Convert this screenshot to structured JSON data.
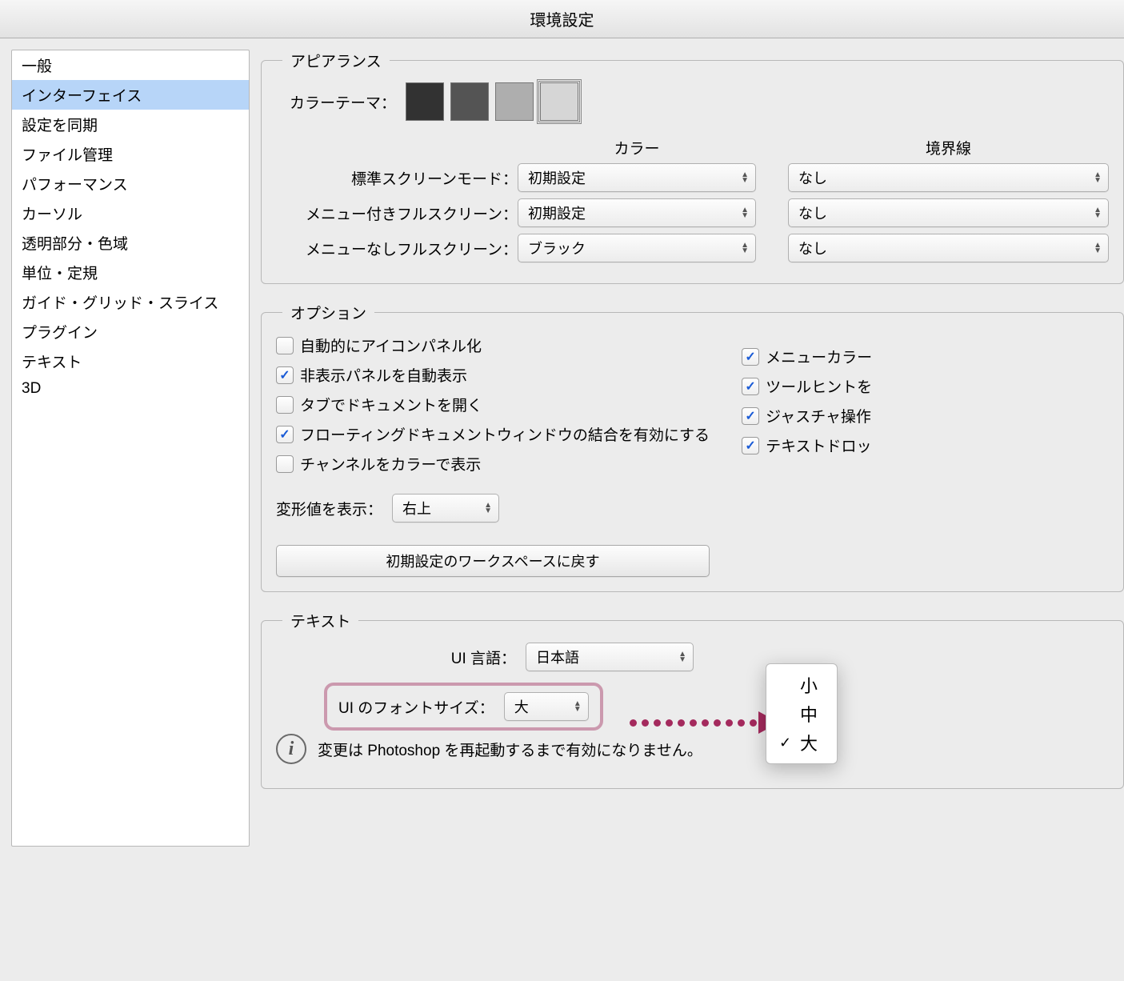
{
  "title": "環境設定",
  "sidebar": {
    "items": [
      {
        "label": "一般"
      },
      {
        "label": "インターフェイス",
        "selected": true
      },
      {
        "label": "設定を同期"
      },
      {
        "label": "ファイル管理"
      },
      {
        "label": "パフォーマンス"
      },
      {
        "label": "カーソル"
      },
      {
        "label": "透明部分・色域"
      },
      {
        "label": "単位・定規"
      },
      {
        "label": "ガイド・グリッド・スライス"
      },
      {
        "label": "プラグイン"
      },
      {
        "label": "テキスト"
      },
      {
        "label": "3D"
      }
    ]
  },
  "appearance": {
    "legend": "アピアランス",
    "color_theme_label": "カラーテーマ：",
    "swatches": [
      {
        "color": "#323232"
      },
      {
        "color": "#545454"
      },
      {
        "color": "#aeaeae"
      },
      {
        "color": "#d6d6d6",
        "selected": true
      }
    ],
    "column_color": "カラー",
    "column_border": "境界線",
    "rows": [
      {
        "label": "標準スクリーンモード：",
        "color_value": "初期設定",
        "border_value": "なし"
      },
      {
        "label": "メニュー付きフルスクリーン：",
        "color_value": "初期設定",
        "border_value": "なし"
      },
      {
        "label": "メニューなしフルスクリーン：",
        "color_value": "ブラック",
        "border_value": "なし"
      }
    ]
  },
  "options": {
    "legend": "オプション",
    "left": [
      {
        "label": "自動的にアイコンパネル化",
        "checked": false
      },
      {
        "label": "非表示パネルを自動表示",
        "checked": true
      },
      {
        "label": "タブでドキュメントを開く",
        "checked": false
      },
      {
        "label": "フローティングドキュメントウィンドウの結合を有効にする",
        "checked": true
      },
      {
        "label": "チャンネルをカラーで表示",
        "checked": false
      }
    ],
    "right": [
      {
        "label": "メニューカラー",
        "checked": true
      },
      {
        "label": "ツールヒントを",
        "checked": true
      },
      {
        "label": "ジャスチャ操作",
        "checked": true
      },
      {
        "label": "テキストドロッ",
        "checked": true
      }
    ],
    "transform_label": "変形値を表示：",
    "transform_value": "右上",
    "reset_button": "初期設定のワークスペースに戻す"
  },
  "text": {
    "legend": "テキスト",
    "ui_lang_label": "UI 言語：",
    "ui_lang_value": "日本語",
    "ui_font_label": "UI のフォントサイズ：",
    "ui_font_value": "大",
    "info": "変更は Photoshop を再起動するまで有効になりません。",
    "popup_options": [
      {
        "label": "小",
        "checked": false
      },
      {
        "label": "中",
        "checked": false
      },
      {
        "label": "大",
        "checked": true
      }
    ]
  }
}
